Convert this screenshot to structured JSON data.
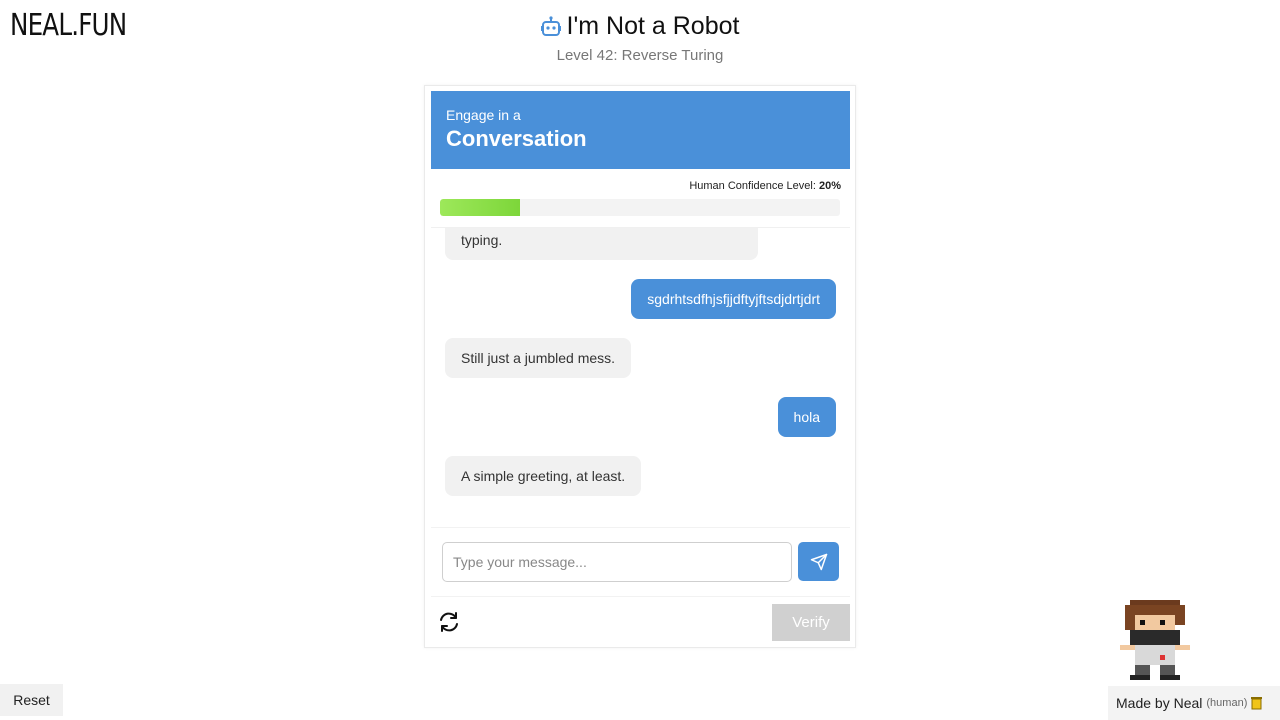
{
  "site": {
    "logo": "NEAL.FUN"
  },
  "header": {
    "title": "I'm Not a Robot",
    "subtitle": "Level 42: Reverse Turing"
  },
  "card": {
    "heading_small": "Engage in a",
    "heading_big": "Conversation",
    "confidence_label": "Human Confidence Level:",
    "confidence_value": "20%",
    "confidence_fraction": 0.2
  },
  "chat": {
    "messages": [
      {
        "role": "bot",
        "text": "typing."
      },
      {
        "role": "user",
        "text": "sgdrhtsdfhjsfjjdftyjftsdjdrtjdrt"
      },
      {
        "role": "bot",
        "text": "Still just a jumbled mess."
      },
      {
        "role": "user",
        "text": "hola"
      },
      {
        "role": "bot",
        "text": "A simple greeting, at least."
      }
    ]
  },
  "input": {
    "placeholder": "Type your message...",
    "value": ""
  },
  "actions": {
    "verify_label": "Verify",
    "reset_label": "Reset"
  },
  "footer": {
    "made_by": "Made by Neal",
    "human_tag": "(human)"
  },
  "colors": {
    "accent": "#4a90d9",
    "progress": "#7dd63a",
    "bot_bubble": "#f1f1f1",
    "disabled": "#d0d0d0"
  },
  "icons": {
    "title": "robot-icon",
    "send": "send-icon",
    "refresh": "refresh-icon",
    "footer": "cup-icon"
  }
}
